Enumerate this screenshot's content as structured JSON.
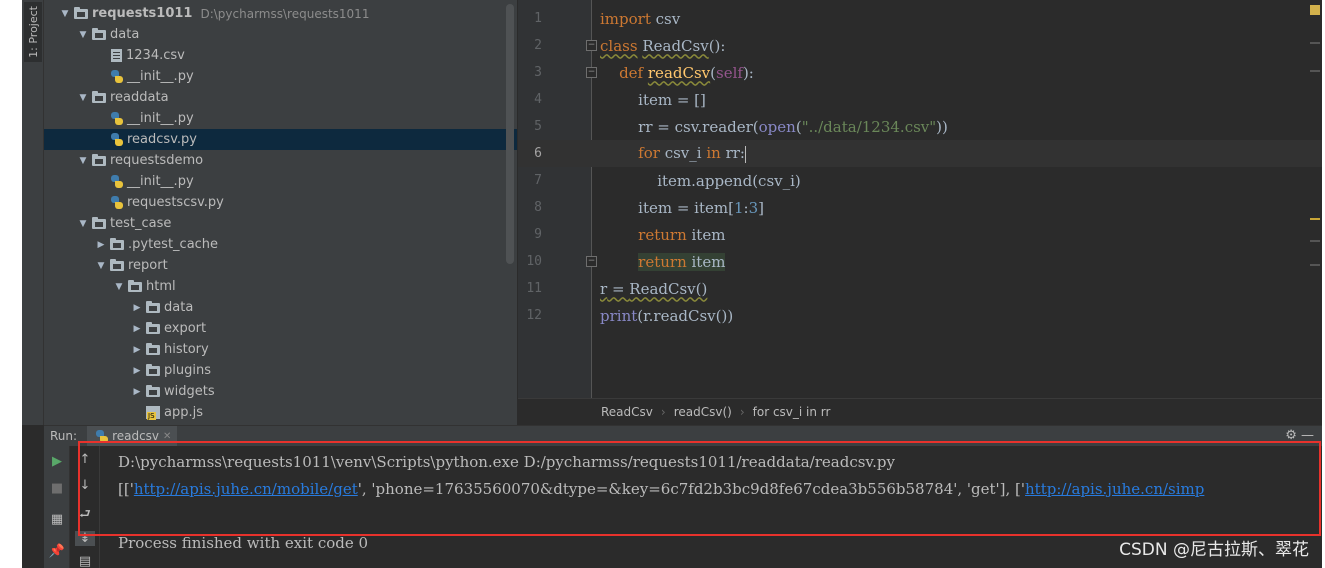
{
  "side_tab": "1: Project",
  "tree": [
    {
      "depth": 0,
      "arrow": "down",
      "icon": "folder",
      "label": "requests1011",
      "path": "D:\\pycharmss\\requests1011",
      "root": true
    },
    {
      "depth": 1,
      "arrow": "down",
      "icon": "folder",
      "label": "data"
    },
    {
      "depth": 2,
      "arrow": "none",
      "icon": "file",
      "label": "1234.csv"
    },
    {
      "depth": 2,
      "arrow": "none",
      "icon": "py",
      "label": "__init__.py"
    },
    {
      "depth": 1,
      "arrow": "down",
      "icon": "folder",
      "label": "readdata"
    },
    {
      "depth": 2,
      "arrow": "none",
      "icon": "py",
      "label": "__init__.py"
    },
    {
      "depth": 2,
      "arrow": "none",
      "icon": "py",
      "label": "readcsv.py",
      "selected": true
    },
    {
      "depth": 1,
      "arrow": "down",
      "icon": "folder",
      "label": "requestsdemo"
    },
    {
      "depth": 2,
      "arrow": "none",
      "icon": "py",
      "label": "__init__.py"
    },
    {
      "depth": 2,
      "arrow": "none",
      "icon": "py",
      "label": "requestscsv.py"
    },
    {
      "depth": 1,
      "arrow": "down",
      "icon": "folder",
      "label": "test_case"
    },
    {
      "depth": 2,
      "arrow": "right",
      "icon": "folder",
      "label": ".pytest_cache"
    },
    {
      "depth": 2,
      "arrow": "down",
      "icon": "folder",
      "label": "report"
    },
    {
      "depth": 3,
      "arrow": "down",
      "icon": "folder",
      "label": "html"
    },
    {
      "depth": 4,
      "arrow": "right",
      "icon": "folder",
      "label": "data"
    },
    {
      "depth": 4,
      "arrow": "right",
      "icon": "folder",
      "label": "export"
    },
    {
      "depth": 4,
      "arrow": "right",
      "icon": "folder",
      "label": "history"
    },
    {
      "depth": 4,
      "arrow": "right",
      "icon": "folder",
      "label": "plugins"
    },
    {
      "depth": 4,
      "arrow": "right",
      "icon": "folder",
      "label": "widgets"
    },
    {
      "depth": 4,
      "arrow": "none",
      "icon": "js",
      "label": "app.js"
    }
  ],
  "editor": {
    "line_numbers": [
      "1",
      "2",
      "3",
      "4",
      "5",
      "6",
      "7",
      "8",
      "9",
      "10",
      "11",
      "12"
    ],
    "current_line": 6,
    "lines": {
      "l1": {
        "kw": "import",
        "rest": " csv"
      },
      "l2": {
        "kw": "class",
        "name": "ReadCsv",
        "rest": "():"
      },
      "l3": {
        "kw": "def",
        "name": "readCsv",
        "open": "(",
        "self": "self",
        "close": "):"
      },
      "l4": {
        "text": "item = []"
      },
      "l5": {
        "pre": "rr = csv.reader(",
        "bi": "open",
        "open": "(",
        "str": "\"../data/1234.csv\"",
        "close": "))"
      },
      "l6": {
        "kw": "for",
        "mid": " csv_i ",
        "kw2": "in",
        "rest": " rr:"
      },
      "l7": {
        "text": "item.append(csv_i)"
      },
      "l8": {
        "pre": "item = item[",
        "n1": "1",
        "colon": ":",
        "n2": "3",
        "close": "]"
      },
      "l9": {
        "kw": "return",
        "rest": " item"
      },
      "l10": {
        "kw": "return",
        "rest": " item"
      },
      "l11": {
        "lhs": "r",
        "mid": " = ",
        "call": "ReadCsv()"
      },
      "l12": {
        "bi": "print",
        "rest": "(r.readCsv())"
      }
    }
  },
  "breadcrumb": [
    "ReadCsv",
    "readCsv()",
    "for csv_i in rr"
  ],
  "run": {
    "label": "Run:",
    "tab": "readcsv",
    "cmd": "D:\\pycharmss\\requests1011\\venv\\Scripts\\python.exe D:/pycharmss/requests1011/readdata/readcsv.py",
    "out_open": "[['",
    "url1": "http://apis.juhe.cn/mobile/get",
    "out_mid": "', 'phone=17635560070&dtype=&key=6c7fd2b3bc9d8fe67cdea3b556b58784', 'get'], ['",
    "url2": "http://apis.juhe.cn/simp",
    "finished": "Process finished with exit code 0"
  },
  "watermark": "CSDN @尼古拉斯、翠花",
  "colors": {
    "keyword": "#cc7832",
    "function": "#ffc66d",
    "string": "#6a8759",
    "number": "#6897bb",
    "link": "#287bde",
    "highlight_box": "#e8322c"
  }
}
